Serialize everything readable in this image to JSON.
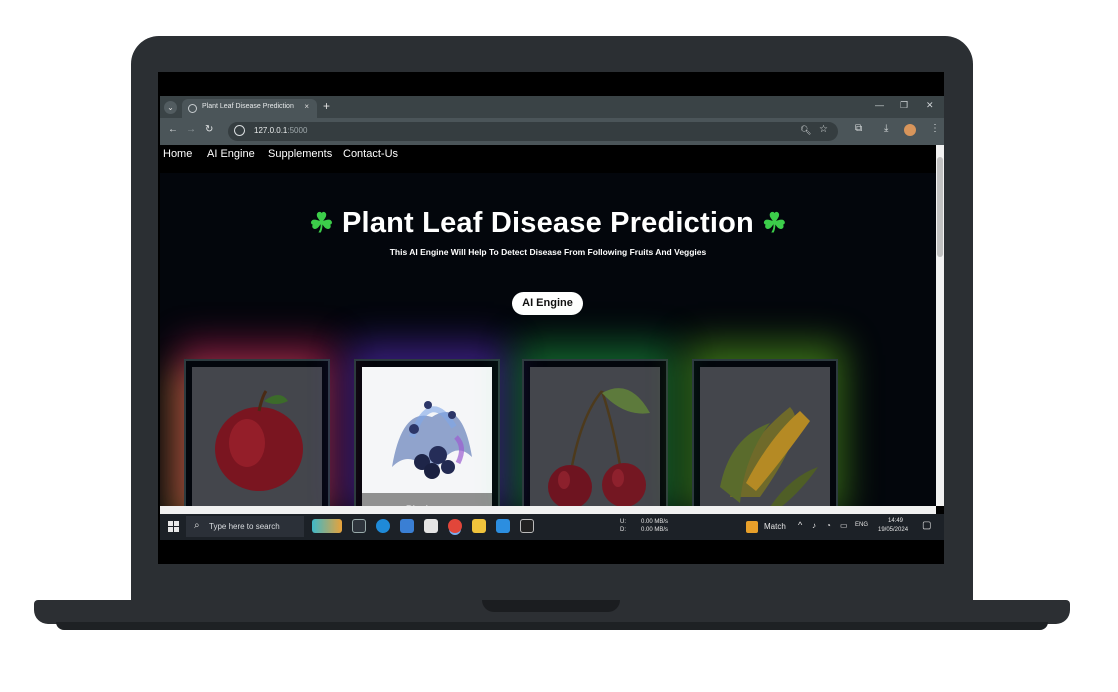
{
  "browser": {
    "tab_title": "Plant Leaf Disease Prediction",
    "tab_close": "×",
    "new_tab": "+",
    "url_host": "127.0.0.1",
    "url_port": ":5000"
  },
  "navbar": {
    "items": [
      "Home",
      "AI Engine",
      "Supplements",
      "Contact-Us"
    ]
  },
  "hero": {
    "title": "Plant Leaf Disease Prediction",
    "clover": "☘",
    "subtitle": "This AI Engine Will Help To Detect Disease From Following Fruits And Veggies",
    "button": "AI Engine"
  },
  "cards": [
    {
      "icon": "apple-image",
      "label": "",
      "glow": "#ff2e7a"
    },
    {
      "icon": "blueberry-image",
      "label": "Blueberry",
      "glow": "#7b3cff"
    },
    {
      "icon": "cherry-image",
      "label": "",
      "glow": "#27e35a"
    },
    {
      "icon": "corn-image",
      "label": "",
      "glow": "#86ff2a"
    }
  ],
  "taskbar": {
    "search_placeholder": "Type here to search",
    "net_up_label": "U:",
    "net_down_label": "D:",
    "net_up": "0.00 MB/s",
    "net_down": "0.00 MB/s",
    "match_label": "Match",
    "lang": "ENG",
    "time": "14:49",
    "date": "19/05/2024"
  }
}
